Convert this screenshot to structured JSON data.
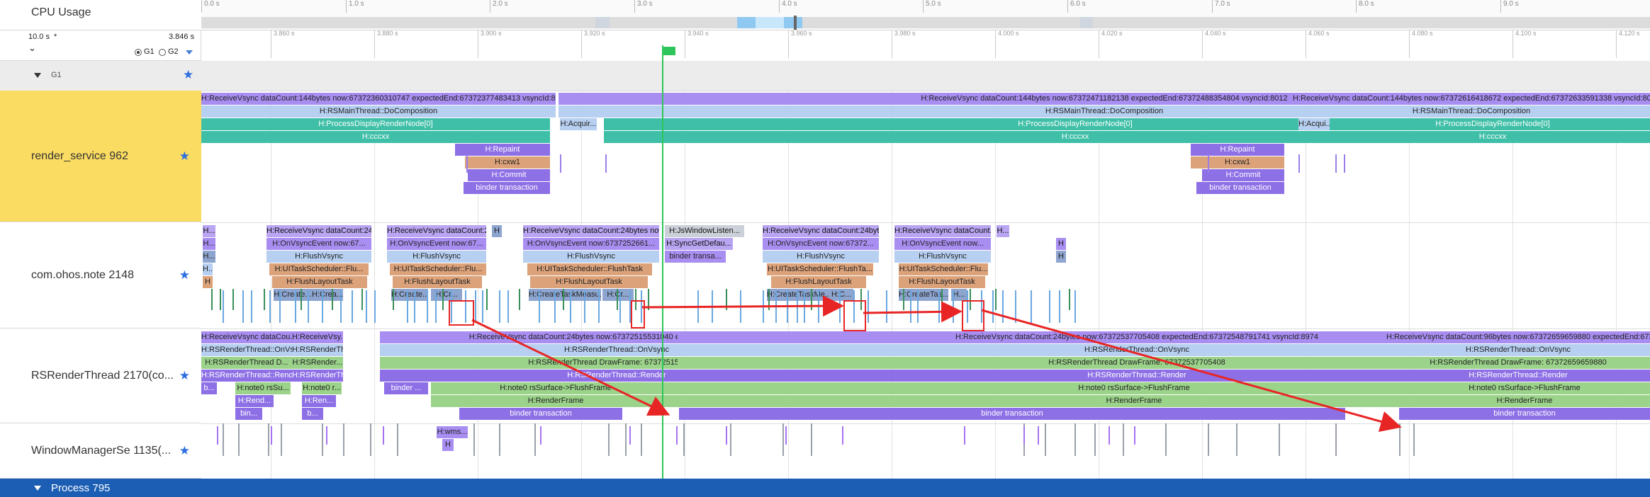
{
  "edge_label": "2",
  "header": {
    "title": "CPU Usage",
    "range_total": "10.0 s",
    "range_asterisk": "*",
    "range_current": "3.846 s",
    "collapse_symbol": "⌄",
    "group1": "G1",
    "group2": "G2",
    "timeline_ticks": [
      "0.0 s",
      "1.0 s",
      "2.0 s",
      "3.0 s",
      "4.0 s",
      "5.0 s",
      "6.0 s",
      "7.0 s",
      "8.0 s",
      "9.0 s"
    ],
    "zoom_ticks": [
      "3.860 s",
      "3.880 s",
      "3.900 s",
      "3.920 s",
      "3.940 s",
      "3.960 s",
      "3.980 s",
      "4.000 s",
      "4.020 s",
      "4.040 s",
      "4.060 s",
      "4.080 s",
      "4.100 s",
      "4.120 s"
    ]
  },
  "group_row": {
    "label": "G1"
  },
  "tracks": [
    {
      "name": "render_service 962"
    },
    {
      "name": "com.ohos.note 2148"
    },
    {
      "name": "RSRenderThread 2170(co..."
    },
    {
      "name": "WindowManagerSe 1135(..."
    }
  ],
  "bottom_bar": {
    "label": "Process 795"
  },
  "colors": {
    "accent": "#2e6fe0",
    "highlight_row": "#fbdc62",
    "marker": "#2ec65a",
    "arrow": "#e82525",
    "bottom_bar": "#1b5eb4"
  },
  "slices": {
    "rs": [
      "H:ReceiveVsync dataCount:144bytes now:67372360310747 expectedEnd:67372377483413 vsyncId:8002...",
      "H:RSMainThread::DoComposition",
      "H:ProcessDisplayRenderNode[0]",
      "H:cccxx",
      "H:Repaint",
      "H:cxw1",
      "H:Commit",
      "binder transaction",
      "H:Acquir...",
      "H:ReceiveVsync dataCount:144bytes now:67372471182138 expectedEnd:67372488354804 vsyncId:8012",
      "H:RSMainThread::DoComposition",
      "H:ProcessDisplayRenderNode[0]",
      "H:cccxx",
      "H:Repaint",
      "H:cxw1",
      "H:Commit",
      "binder transaction",
      "H:Acqui...",
      "H:ReceiveVsync dataCount:144bytes now:67372616418672 expectedEnd:67372633591338 vsyncId:8025...",
      "H:RSMainThread::DoComposition",
      "H:ProcessDisplayRenderNode[0]",
      "H:cccxx"
    ],
    "note": [
      "H...",
      "H...",
      "H...",
      "H...",
      "H",
      "H:ReceiveVsync dataCount:24...",
      "H:OnVsyncEvent now:67...",
      "H:FlushVsync",
      "H:UITaskScheduler::Flu...",
      "H:FlushLayoutTask",
      "H:Create...",
      "H:Crea...",
      "H:ReceiveVsync dataCount:2...",
      "H:OnVsyncEvent now:67...",
      "H:FlushVsync",
      "H:UITaskScheduler::Flu...",
      "H:FlushLayoutTask",
      "H:Create...",
      "H:Cr...",
      "H",
      "H:ReceiveVsync dataCount:24bytes now...",
      "H:OnVsyncEvent now:6737252661...",
      "H:FlushVsync",
      "H:UITaskScheduler::FlushTask",
      "H:FlushLayoutTask",
      "H:CreateTaskMeasu...",
      "H:Cr...",
      "H:JsWindowListen...",
      "H:SyncGetDefau...",
      "binder transa...",
      "H:ReceiveVsync dataCount:24byt...",
      "H:OnVsyncEvent now:67372...",
      "H:FlushVsync",
      "H:UITaskScheduler::FlushTa...",
      "H:FlushLayoutTask",
      "H:CreateTaskMe...",
      "H:C...",
      "H:ReceiveVsync dataCount...",
      "H:OnVsyncEvent now...",
      "H:FlushVsync",
      "H:UITaskScheduler::Flu...",
      "H:FlushLayoutTask",
      "H:CreateTas...",
      "H...",
      "H...",
      "H",
      "H"
    ],
    "rsr": [
      "H:ReceiveVsync dataCou...",
      "H:RSRenderThread::OnVs...",
      "H:RSRenderThread D...",
      "H:RSRenderThread::Rend...",
      "b...",
      "H:note0 rsSu...",
      "H:Rend...",
      "bin...",
      "H:ReceiveVsy...",
      "H:RSRenderTh...",
      "H:RSRender...",
      "H:RSRenderTh...",
      "H:note0 r...",
      "H:Ren...",
      "b...",
      "H:ReceiveVsync dataCount:24bytes now:67372515531040 expectedEnd:67372566...",
      "H:RSRenderThread::OnVsync",
      "H:RSRenderThread DrawFrame: 67372515531040",
      "H:RSRenderThread::Render",
      "binder ...",
      "H:note0 rsSurface->FlushFrame",
      "H:RenderFrame",
      "binder transaction",
      "H:ReceiveVsync dataCount:24bytes now:67372537705408 expectedEnd:67372548791741 vsyncId:8974",
      "H:RSRenderThread::OnVsync",
      "H:RSRenderThread DrawFrame: 67372537705408",
      "H:RSRenderThread::Render",
      "H:note0 rsSurface->FlushFrame",
      "H:RenderFrame",
      "binder transaction",
      "H:ReceiveVsync dataCount:96bytes now:67372659659880 expectedEnd:673726...",
      "H:RSRenderThread::OnVsync",
      "H:RSRenderThread DrawFrame: 67372659659880",
      "H:RSRenderThread::Render",
      "H:note0 rsSurface->FlushFrame",
      "H:RenderFrame",
      "binder transaction"
    ],
    "wms": [
      "H:wms...",
      "H"
    ]
  }
}
